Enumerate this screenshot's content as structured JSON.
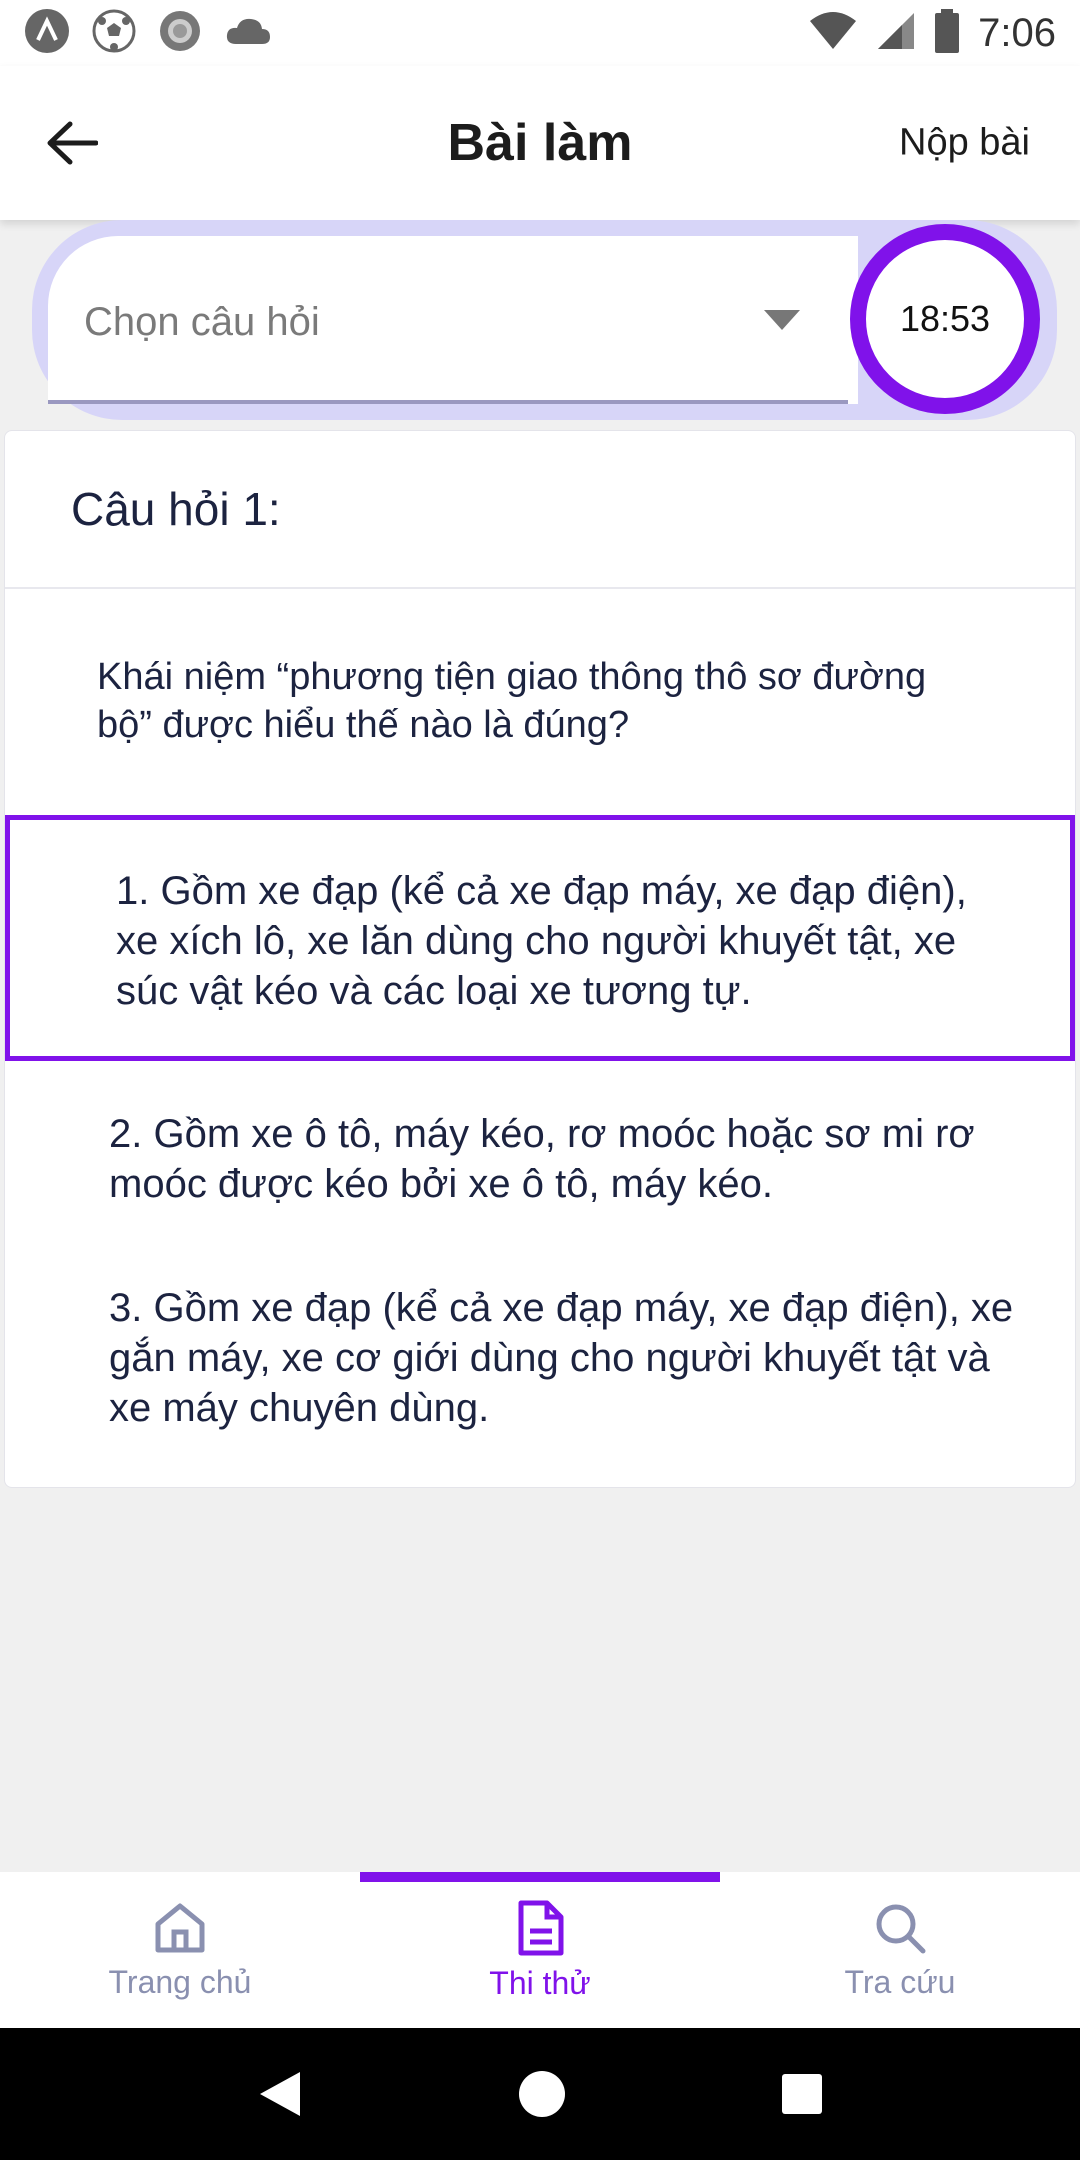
{
  "status_bar": {
    "time": "7:06",
    "left_icons": [
      "app-a-icon",
      "soccer-ball-icon",
      "circle-record-icon",
      "cloud-icon"
    ],
    "right_icons": [
      "wifi-icon",
      "cell-signal-icon",
      "battery-icon"
    ]
  },
  "app_bar": {
    "title": "Bài làm",
    "submit_label": "Nộp bài",
    "back_icon": "arrow-left-icon"
  },
  "selector": {
    "placeholder": "Chọn câu hỏi",
    "timer": "18:53",
    "accent_color": "#8012ea"
  },
  "question": {
    "header": "Câu hỏi 1:",
    "text": "Khái niệm “phương tiện giao thông thô sơ đường bộ” được hiểu thế nào là đúng?",
    "answers": [
      {
        "label": "1. Gồm xe đạp (kể cả xe đạp máy, xe đạp điện), xe xích lô, xe lăn dùng cho người khuyết tật, xe súc vật kéo và các loại xe tương tự.",
        "selected": true
      },
      {
        "label": "2. Gồm xe ô tô, máy kéo, rơ moóc hoặc sơ mi rơ moóc được kéo bởi xe ô tô, máy kéo.",
        "selected": false
      },
      {
        "label": "3. Gồm xe đạp (kể cả xe đạp máy, xe đạp điện), xe gắn máy, xe cơ giới dùng cho người khuyết tật và xe máy chuyên dùng.",
        "selected": false
      }
    ]
  },
  "bottom_nav": {
    "items": [
      {
        "label": "Trang chủ",
        "icon": "home-icon",
        "active": false
      },
      {
        "label": "Thi thử",
        "icon": "document-icon",
        "active": true
      },
      {
        "label": "Tra cứu",
        "icon": "search-icon",
        "active": false
      }
    ]
  },
  "system_nav": {
    "buttons": [
      "back-triangle-icon",
      "home-circle-icon",
      "recents-square-icon"
    ]
  }
}
